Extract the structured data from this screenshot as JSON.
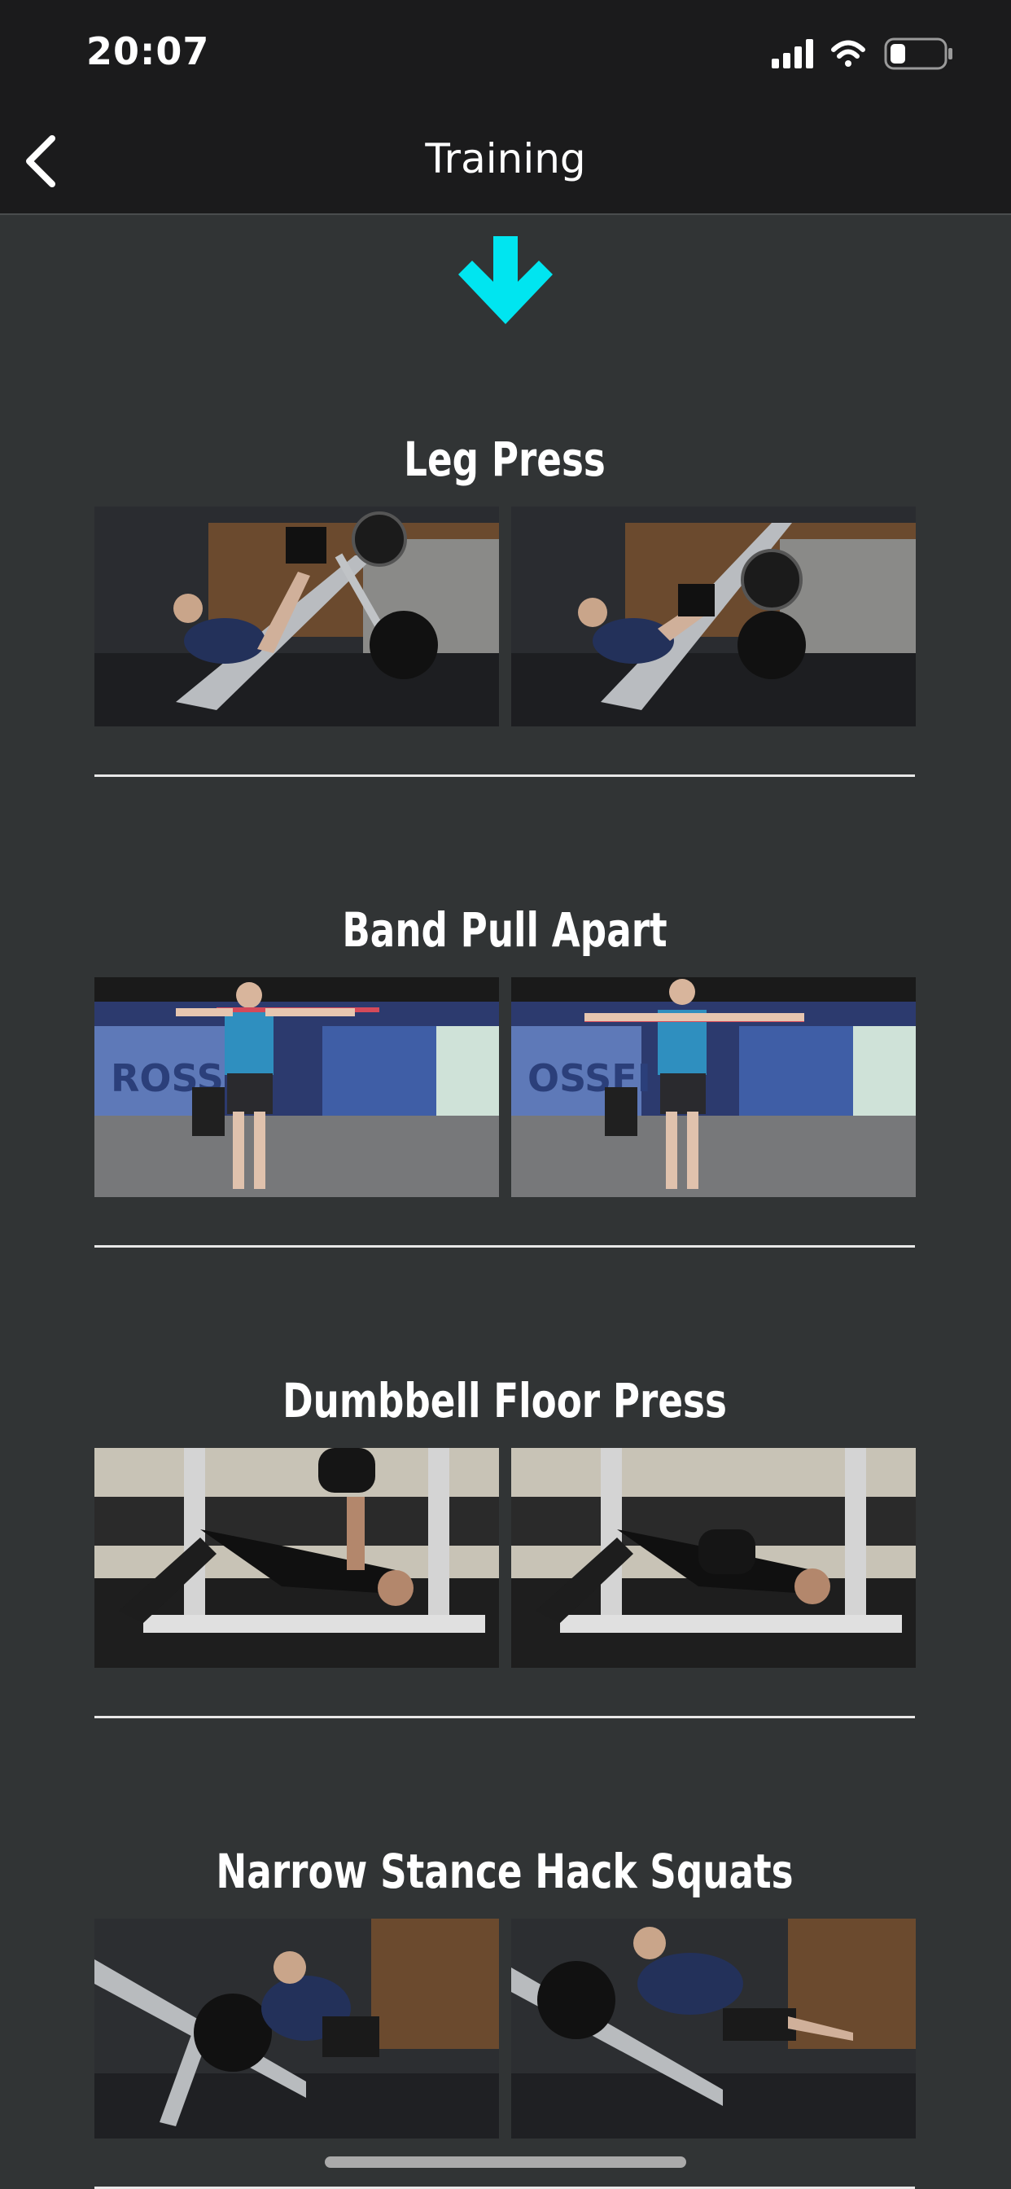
{
  "status_bar": {
    "time": "20:07"
  },
  "nav": {
    "title": "Training"
  },
  "colors": {
    "accent_arrow": "#00e5f0",
    "background": "#313435",
    "bar": "#1b1b1c"
  },
  "icons": {
    "back": "chevron-left-icon",
    "scroll_hint": "arrow-down-icon"
  },
  "exercises": [
    {
      "title": "Leg Press"
    },
    {
      "title": "Band Pull Apart"
    },
    {
      "title": "Dumbbell Floor Press"
    },
    {
      "title": "Narrow Stance Hack Squats"
    }
  ]
}
